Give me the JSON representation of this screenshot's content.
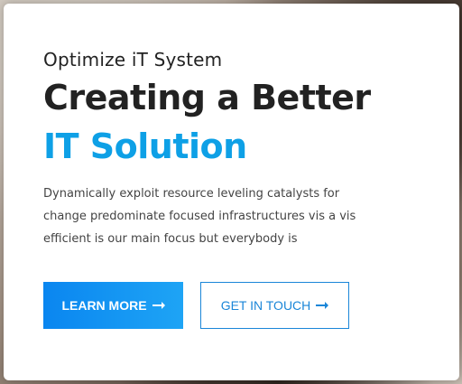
{
  "hero": {
    "eyebrow": "Optimize iT System",
    "title_line1": "Creating a Better",
    "title_line2": "IT Solution",
    "description": "Dynamically exploit resource leveling catalysts for change predominate focused infrastructures vis a vis efficient is our main focus but everybody is",
    "accent_color": "#0ea0e6"
  },
  "buttons": {
    "primary_label": "LEARN MORE",
    "secondary_label": "GET IN TOUCH",
    "primary_icon": "arrow-right-icon",
    "secondary_icon": "arrow-right-icon"
  }
}
